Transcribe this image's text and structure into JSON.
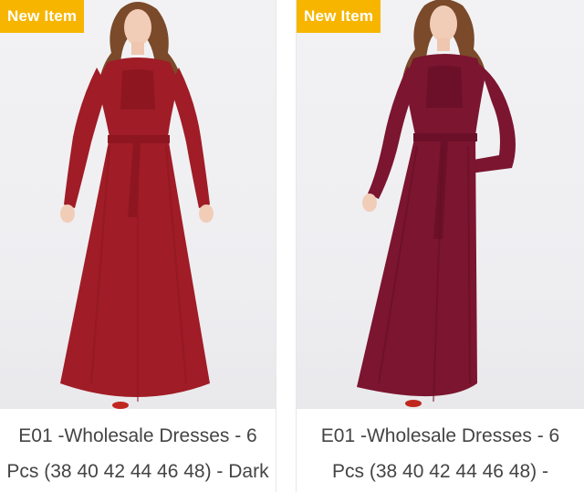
{
  "products": [
    {
      "badge": "New Item",
      "title_line1": "E01 -Wholesale Dresses - 6",
      "title_line2": "Pcs (38 40 42 44 46 48) - Dark",
      "dress_color": "#a01c26"
    },
    {
      "badge": "New Item",
      "title_line1": "E01 -Wholesale Dresses - 6",
      "title_line2": "Pcs (38 40 42 44 46 48) -",
      "dress_color": "#7c1530"
    }
  ],
  "colors": {
    "badge_bg": "#f7b500",
    "title_text": "#444444"
  }
}
